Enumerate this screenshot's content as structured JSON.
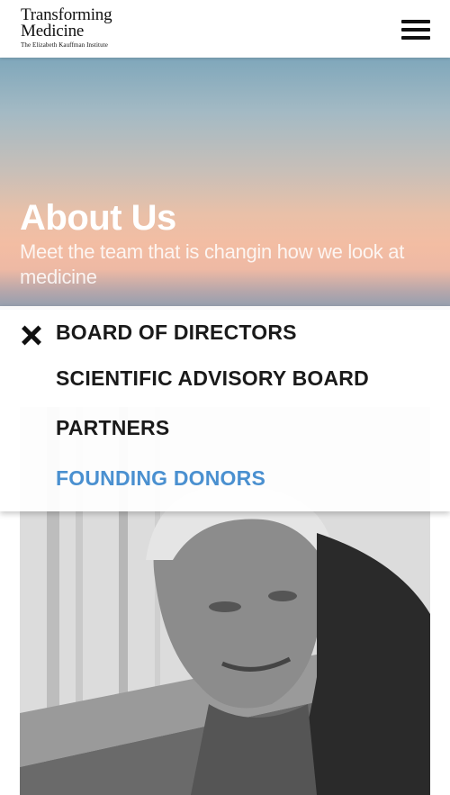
{
  "header": {
    "logo_line1": "Transforming",
    "logo_line2": "Medicine",
    "logo_sub": "The Elizabeth Kauffman Institute"
  },
  "hero": {
    "title": "About Us",
    "subtitle": "Meet the team that is changin how  we look at medicine"
  },
  "menu": {
    "items": [
      {
        "label": "BOARD OF DIRECTORS"
      },
      {
        "label": "SCIENTIFIC ADVISORY BOARD"
      },
      {
        "label": "PARTNERS"
      },
      {
        "label": "FOUNDING DONORS"
      }
    ],
    "active_color": "#4a90d0"
  },
  "icons": [
    "hamburger-menu-icon",
    "close-icon"
  ],
  "photo": {
    "style": "grayscale"
  }
}
